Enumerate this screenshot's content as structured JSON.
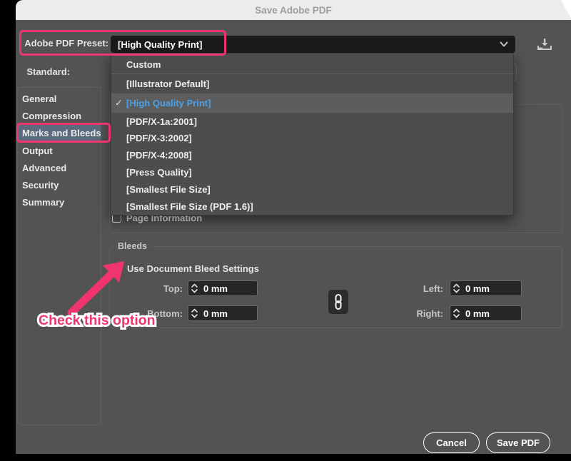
{
  "window": {
    "title": "Save Adobe PDF"
  },
  "preset": {
    "label": "Adobe PDF Preset:",
    "value": "[High Quality Print]"
  },
  "standard": {
    "label": "Standard:"
  },
  "menu": {
    "checkmark_glyph": "✓",
    "items": [
      {
        "label": "Custom",
        "selected": false
      },
      {
        "label": "[Illustrator Default]",
        "selected": false
      },
      {
        "label": "[High Quality Print]",
        "selected": true
      },
      {
        "label": "[PDF/X-1a:2001]",
        "selected": false
      },
      {
        "label": "[PDF/X-3:2002]",
        "selected": false
      },
      {
        "label": "[PDF/X-4:2008]",
        "selected": false
      },
      {
        "label": "[Press Quality]",
        "selected": false
      },
      {
        "label": "[Smallest File Size]",
        "selected": false
      },
      {
        "label": "[Smallest File Size (PDF 1.6)]",
        "selected": false
      }
    ]
  },
  "sidebar": {
    "items": [
      {
        "label": "General",
        "selected": false
      },
      {
        "label": "Compression",
        "selected": false
      },
      {
        "label": "Marks and Bleeds",
        "selected": true
      },
      {
        "label": "Output",
        "selected": false
      },
      {
        "label": "Advanced",
        "selected": false
      },
      {
        "label": "Security",
        "selected": false
      },
      {
        "label": "Summary",
        "selected": false
      }
    ]
  },
  "marks": {
    "page_information_label": "Page Information"
  },
  "bleeds": {
    "legend": "Bleeds",
    "use_document_label": "Use Document Bleed Settings",
    "use_document_checked": false,
    "fields": [
      {
        "label": "Top:",
        "value": "0 mm"
      },
      {
        "label": "Bottom:",
        "value": "0 mm"
      },
      {
        "label": "Left:",
        "value": "0 mm"
      },
      {
        "label": "Right:",
        "value": "0 mm"
      }
    ]
  },
  "buttons": {
    "cancel": "Cancel",
    "save": "Save PDF"
  },
  "annotations": {
    "check_text": "Check this option",
    "highlight_color": "#f0356e"
  },
  "colors": {
    "dialog_bg": "#535353",
    "titlebar_bg": "#ececeb",
    "field_bg": "#1b1b1b",
    "menu_bg": "#4d4d4d",
    "menu_selected_bg": "#5d5d5d",
    "menu_selected_text": "#4ba1e8",
    "sidebar_selected_bg": "#5b6a7c",
    "annotation_pink": "#f0356e"
  }
}
